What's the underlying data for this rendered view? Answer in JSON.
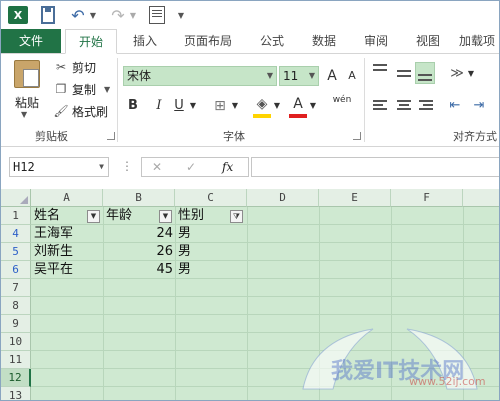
{
  "tabs": [
    {
      "label": "文件"
    },
    {
      "label": "开始"
    },
    {
      "label": "插入"
    },
    {
      "label": "页面布局"
    },
    {
      "label": "公式"
    },
    {
      "label": "数据"
    },
    {
      "label": "审阅"
    },
    {
      "label": "视图"
    },
    {
      "label": "加载项"
    }
  ],
  "ribbon": {
    "clipboard": {
      "paste": "粘贴",
      "cut": "剪切",
      "copy": "复制",
      "format_painter": "格式刷",
      "group_label": "剪贴板"
    },
    "font": {
      "font_name": "宋体",
      "font_size": "11",
      "group_label": "字体",
      "bold": "B",
      "italic": "I",
      "underline": "U",
      "increase": "A",
      "decrease": "A",
      "phonetic": "wén"
    },
    "alignment": {
      "group_label": "对齐方式"
    }
  },
  "formula_bar": {
    "name_box": "H12",
    "cancel": "✕",
    "enter": "✓",
    "fx": "fx",
    "formula": ""
  },
  "sheet": {
    "columns": [
      "A",
      "B",
      "C",
      "D",
      "E",
      "F"
    ],
    "rows": [
      "1",
      "4",
      "5",
      "6",
      "7",
      "8",
      "9",
      "10",
      "11",
      "12",
      "13"
    ],
    "filtered_rows": [
      "4",
      "5",
      "6"
    ],
    "selected_row": "12",
    "headers": [
      "姓名",
      "年龄",
      "性别"
    ],
    "data": [
      {
        "name": "王海军",
        "age": "24",
        "gender": "男"
      },
      {
        "name": "刘新生",
        "age": "26",
        "gender": "男"
      },
      {
        "name": "吴平在",
        "age": "45",
        "gender": "男"
      }
    ]
  },
  "colors": {
    "brand": "#217346",
    "grid_bg": "#cfe9d1"
  },
  "watermark": {
    "text": "我爱IT技术网",
    "url": "www.52ij.com"
  }
}
